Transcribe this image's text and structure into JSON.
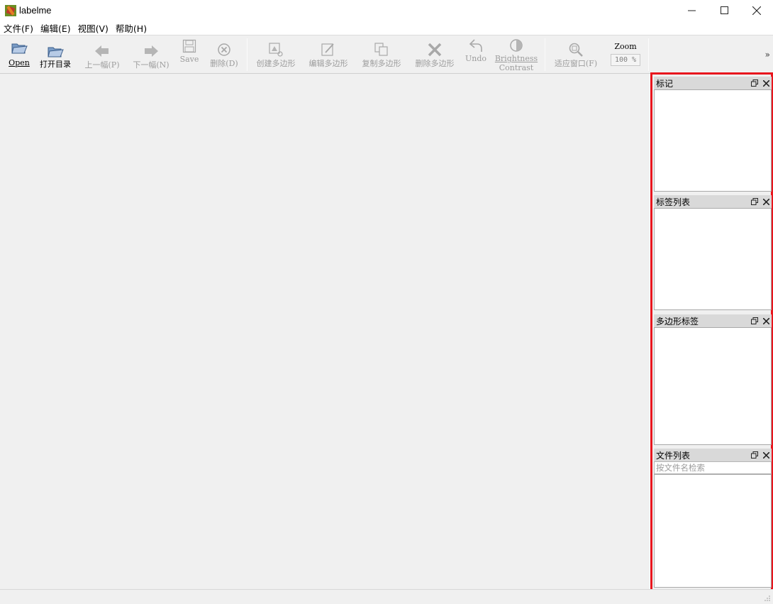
{
  "window": {
    "title": "labelme",
    "controls": [
      "minimize",
      "maximize",
      "close"
    ]
  },
  "menu": [
    "文件(F)",
    "编辑(E)",
    "视图(V)",
    "帮助(H)"
  ],
  "toolbar": {
    "open": "Open",
    "open_dir": "打开目录",
    "prev": "上一幅(P)",
    "next": "下一幅(N)",
    "save": "Save",
    "delete": "删除(D)",
    "create_polygon": "创建多边形",
    "edit_polygon": "编辑多边形",
    "copy_polygon": "复制多边形",
    "delete_polygon": "删除多边形",
    "undo": "Undo",
    "brightness": "Brightness",
    "contrast": "Contrast",
    "fit_window": "适应窗口(F)",
    "zoom_label": "Zoom",
    "zoom_value": "100 %",
    "overflow": "»"
  },
  "docks": {
    "flags": {
      "title": "标记"
    },
    "labels": {
      "title": "标签列表"
    },
    "polygons": {
      "title": "多边形标签"
    },
    "files": {
      "title": "文件列表",
      "search_placeholder": "按文件名检索"
    }
  },
  "colors": {
    "highlight_border": "#e8161e",
    "toolbar_bg": "#f0f0f0",
    "dock_header_bg": "#d9d9d9"
  }
}
